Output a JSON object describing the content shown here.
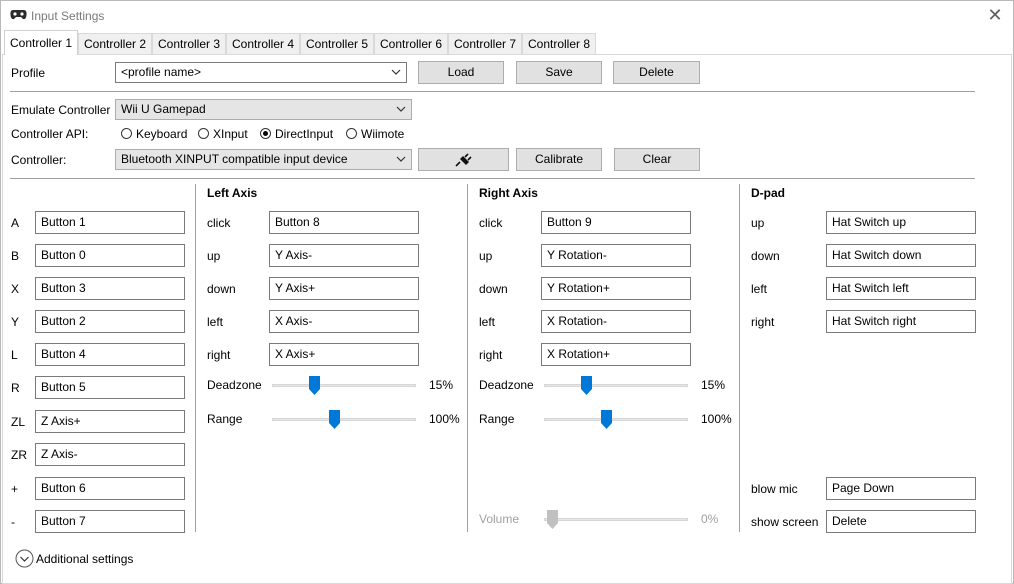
{
  "window": {
    "title": "Input Settings"
  },
  "tabs": [
    "Controller 1",
    "Controller 2",
    "Controller 3",
    "Controller 4",
    "Controller 5",
    "Controller 6",
    "Controller 7",
    "Controller 8"
  ],
  "profile": {
    "label": "Profile",
    "value": "<profile name>",
    "load": "Load",
    "save": "Save",
    "delete": "Delete"
  },
  "emulate": {
    "label": "Emulate Controller",
    "value": "Wii U Gamepad"
  },
  "api": {
    "label": "Controller API:",
    "options": [
      "Keyboard",
      "XInput",
      "DirectInput",
      "Wiimote"
    ],
    "selected": "DirectInput"
  },
  "controller": {
    "label": "Controller:",
    "value": "Bluetooth XINPUT compatible input device",
    "calibrate": "Calibrate",
    "clear": "Clear"
  },
  "buttons": [
    {
      "label": "A",
      "value": "Button 1"
    },
    {
      "label": "B",
      "value": "Button 0"
    },
    {
      "label": "X",
      "value": "Button 3"
    },
    {
      "label": "Y",
      "value": "Button 2"
    },
    {
      "label": "L",
      "value": "Button 4"
    },
    {
      "label": "R",
      "value": "Button 5"
    },
    {
      "label": "ZL",
      "value": "Z Axis+"
    },
    {
      "label": "ZR",
      "value": "Z Axis-"
    },
    {
      "label": "+",
      "value": "Button 6"
    },
    {
      "label": "-",
      "value": "Button 7"
    }
  ],
  "left_axis": {
    "title": "Left Axis",
    "rows": [
      {
        "label": "click",
        "value": "Button 8"
      },
      {
        "label": "up",
        "value": "Y Axis-"
      },
      {
        "label": "down",
        "value": "Y Axis+"
      },
      {
        "label": "left",
        "value": "X Axis-"
      },
      {
        "label": "right",
        "value": "X Axis+"
      }
    ],
    "deadzone": {
      "label": "Deadzone",
      "value": "15%",
      "level": 0.15
    },
    "range": {
      "label": "Range",
      "value": "100%",
      "level": 0.33
    }
  },
  "right_axis": {
    "title": "Right Axis",
    "rows": [
      {
        "label": "click",
        "value": "Button 9"
      },
      {
        "label": "up",
        "value": "Y Rotation-"
      },
      {
        "label": "down",
        "value": "Y Rotation+"
      },
      {
        "label": "left",
        "value": "X Rotation-"
      },
      {
        "label": "right",
        "value": "X Rotation+"
      }
    ],
    "deadzone": {
      "label": "Deadzone",
      "value": "15%",
      "level": 0.15
    },
    "range": {
      "label": "Range",
      "value": "100%",
      "level": 0.33
    },
    "volume": {
      "label": "Volume",
      "value": "0%",
      "level": 0.0
    }
  },
  "dpad": {
    "title": "D-pad",
    "rows": [
      {
        "label": "up",
        "value": "Hat Switch up"
      },
      {
        "label": "down",
        "value": "Hat Switch down"
      },
      {
        "label": "left",
        "value": "Hat Switch left"
      },
      {
        "label": "right",
        "value": "Hat Switch right"
      }
    ],
    "extra": [
      {
        "label": "blow mic",
        "value": "Page Down"
      },
      {
        "label": "show screen",
        "value": "Delete"
      }
    ]
  },
  "additional": {
    "label": "Additional settings"
  },
  "colors": {
    "accent": "#0078d7",
    "disabled": "#c0c0c0"
  }
}
